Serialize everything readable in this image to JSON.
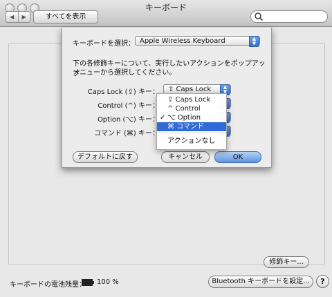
{
  "window": {
    "title": "キーボード"
  },
  "toolbar": {
    "back_label": "◀",
    "forward_label": "▶",
    "show_all_label": "すべてを表示",
    "search_placeholder": ""
  },
  "sheet": {
    "keyboard_select_label": "キーボードを選択：",
    "keyboard_selected": "Apple Wireless Keyboard",
    "instructions_line1": "下の各修飾キーについて、実行したいアクションをポップアップ",
    "instructions_line2": "メニューから選択してください。",
    "modifiers": [
      {
        "label": "Caps Lock (⇪) キー：",
        "value": "⇪ Caps Lock"
      },
      {
        "label": "Control (^) キー：",
        "value": ""
      },
      {
        "label": "Option (⌥) キー：",
        "value": ""
      },
      {
        "label": "コマンド (⌘) キー：",
        "value": ""
      }
    ],
    "menu": {
      "items": [
        "⇪ Caps Lock",
        "^ Control",
        "⌥ Option",
        "⌘ コマンド",
        "アクションなし"
      ],
      "checked": "⌥ Option",
      "highlighted": "⌘ コマンド"
    },
    "buttons": {
      "defaults": "デフォルトに戻す",
      "cancel": "キャンセル",
      "ok": "OK"
    }
  },
  "panel": {
    "modifier_keys_button": "修飾キー...",
    "battery_label": "キーボードの電池残量：",
    "battery_percent": "100 %",
    "bluetooth_button": "Bluetooth キーボードを設定...",
    "help_label": "?"
  },
  "colors": {
    "accent": "#2f6ad6",
    "ok_button": "#5b95e4"
  }
}
